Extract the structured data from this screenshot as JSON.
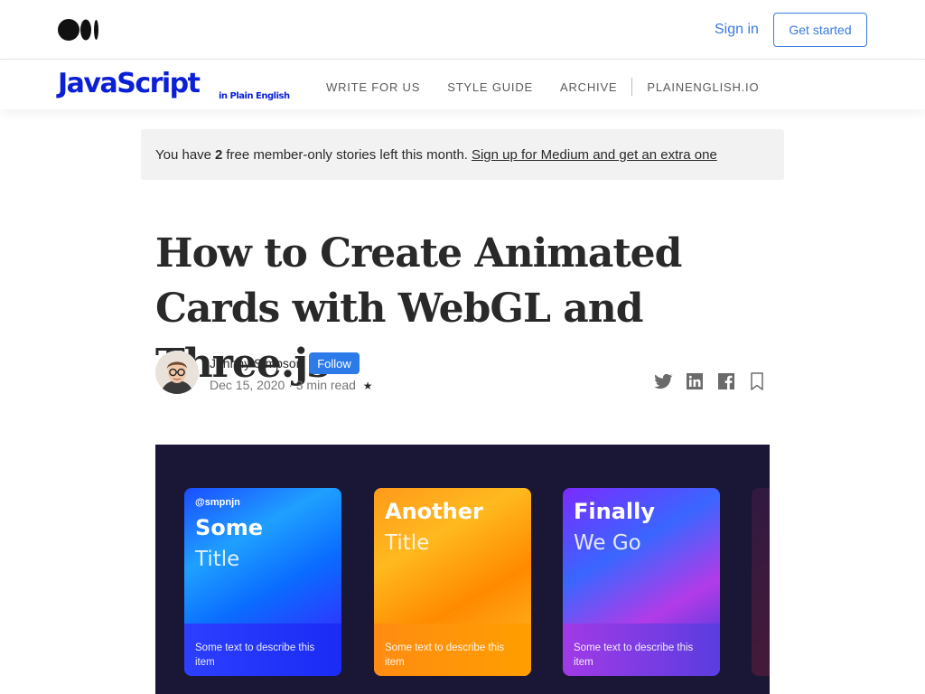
{
  "topbar": {
    "logo_icon": "medium-logo-icon",
    "signin_label": "Sign in",
    "getstarted_label": "Get started"
  },
  "publication": {
    "logo_main": "JavaScript",
    "logo_sub": "in Plain English",
    "nav": [
      "WRITE FOR US",
      "STYLE GUIDE",
      "ARCHIVE",
      "PLAINENGLISH.IO"
    ],
    "brand_color": "#0b1fd6"
  },
  "banner": {
    "text_before": "You have",
    "count": "2",
    "text_after": "free member-only stories left this month.",
    "link": "Sign up for Medium and get an extra one"
  },
  "article": {
    "title": "How to Create Animated Cards with WebGL and Three.js",
    "author": "Johnny Simpson",
    "follow_label": "Follow",
    "date": "Dec 15, 2020",
    "read_time": "3 min read",
    "member_star": "★",
    "share_icons": [
      "twitter-icon",
      "linkedin-icon",
      "facebook-icon",
      "bookmark-icon"
    ]
  },
  "hero": {
    "cards": [
      {
        "handle": "@smpnjn",
        "title": "Some",
        "subtitle": "Title",
        "desc": "Some text to describe this item"
      },
      {
        "handle": "",
        "title": "Another",
        "subtitle": "Title",
        "desc": "Some text to describe this item"
      },
      {
        "handle": "",
        "title": "Finally",
        "subtitle": "We Go",
        "desc": "Some text to describe this item"
      }
    ]
  }
}
